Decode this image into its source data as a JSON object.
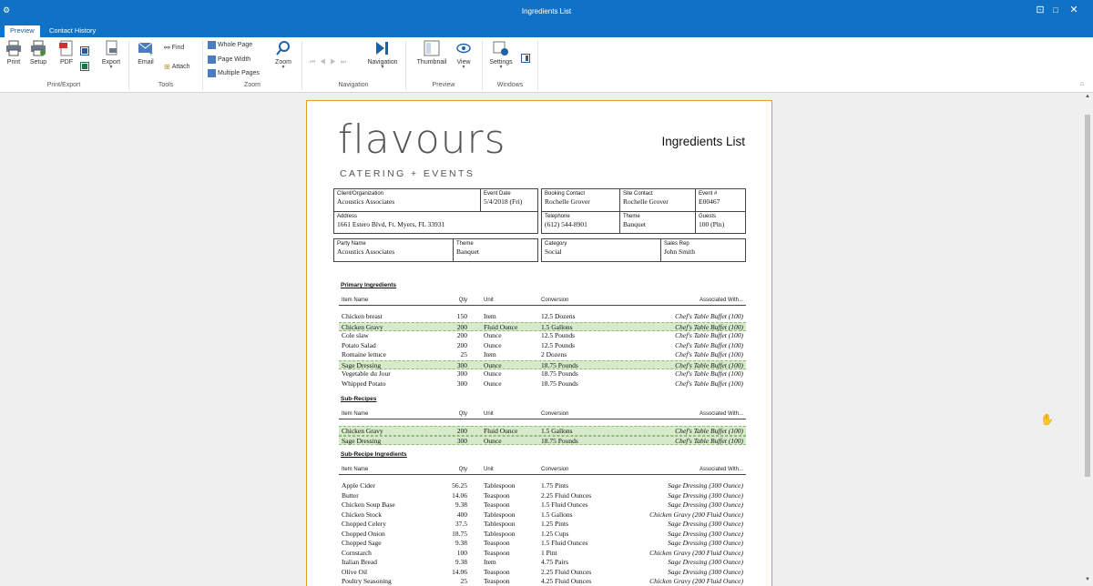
{
  "window": {
    "title": "Ingredients List",
    "app_icon": "app-icon"
  },
  "ribbon_tabs": [
    "Preview",
    "Contact History"
  ],
  "ribbon": {
    "print_export": {
      "print": "Print",
      "setup": "Setup",
      "pdf": "PDF",
      "export": "Export",
      "group": "Print/Export"
    },
    "tools": {
      "email": "Email",
      "find": "Find",
      "attach": "Attach",
      "group": "Tools"
    },
    "zoom": {
      "whole_page": "Whole Page",
      "page_width": "Page Width",
      "multiple_pages": "Multiple Pages",
      "zoom": "Zoom",
      "group": "Zoom"
    },
    "navigation": {
      "navigation": "Navigation",
      "group": "Navigation"
    },
    "preview": {
      "thumbnail": "Thumbnail",
      "view": "View",
      "group": "Preview"
    },
    "windows": {
      "settings": "Settings",
      "group": "Windows"
    }
  },
  "report": {
    "logo_word": "flavours",
    "logo_sub": "CATERING + EVENTS",
    "title": "Ingredients List",
    "box1": {
      "client_label": "Client/Organization",
      "client": "Acoustics Associates",
      "date_label": "Event Date",
      "date": "5/4/2018 (Fri)",
      "address_label": "Address",
      "address": "1661 Estero Blvd, Ft. Myers, FL 33931"
    },
    "box2": {
      "booking_label": "Booking Contact",
      "booking": "Rochelle Grover",
      "site_label": "Site Contact",
      "site": "Rochelle Grover",
      "event_label": "Event #",
      "event": "E00467",
      "phone_label": "Telephone",
      "phone": "(612) 544-8901",
      "theme_label": "Theme",
      "theme": "Banquet",
      "guests_label": "Guests",
      "guests": "100 (Pln)"
    },
    "box3": {
      "party_label": "Party Name",
      "party": "Acoustics Associates",
      "theme_label": "Theme",
      "theme": "Banquet"
    },
    "box4": {
      "category_label": "Category",
      "category": "Social",
      "rep_label": "Sales Rep",
      "rep": "John Smith"
    },
    "columns": {
      "name": "Item Name",
      "qty": "Qty",
      "unit": "Unit",
      "conv": "Conversion",
      "assoc": "Associated With..."
    },
    "sections": [
      {
        "title": "Primary Ingredients",
        "rows": [
          {
            "name": "Chicken breast",
            "qty": "150",
            "unit": "Item",
            "conv": "12.5 Dozens",
            "assoc": "Chef's Table Buffet (100)",
            "hl": false
          },
          {
            "name": "Chicken Gravy",
            "qty": "200",
            "unit": "Fluid Ounce",
            "conv": "1.5 Gallons",
            "assoc": "Chef's Table Buffet (100)",
            "hl": true
          },
          {
            "name": "Cole slaw",
            "qty": "200",
            "unit": "Ounce",
            "conv": "12.5 Pounds",
            "assoc": "Chef's Table Buffet (100)",
            "hl": false
          },
          {
            "name": "Potato Salad",
            "qty": "200",
            "unit": "Ounce",
            "conv": "12.5 Pounds",
            "assoc": "Chef's Table Buffet (100)",
            "hl": false
          },
          {
            "name": "Romaine lettuce",
            "qty": "25",
            "unit": "Item",
            "conv": "2 Dozens",
            "assoc": "Chef's Table Buffet (100)",
            "hl": false
          },
          {
            "name": "Sage Dressing",
            "qty": "300",
            "unit": "Ounce",
            "conv": "18.75 Pounds",
            "assoc": "Chef's Table Buffet (100)",
            "hl": true
          },
          {
            "name": "Vegetable du Jour",
            "qty": "300",
            "unit": "Ounce",
            "conv": "18.75 Pounds",
            "assoc": "Chef's Table Buffet (100)",
            "hl": false
          },
          {
            "name": "Whipped Potato",
            "qty": "300",
            "unit": "Ounce",
            "conv": "18.75 Pounds",
            "assoc": "Chef's Table Buffet (100)",
            "hl": false
          }
        ]
      },
      {
        "title": "Sub-Recipes",
        "rows": [
          {
            "name": "Chicken Gravy",
            "qty": "200",
            "unit": "Fluid Ounce",
            "conv": "1.5 Gallons",
            "assoc": "Chef's Table Buffet (100)",
            "hl": true
          },
          {
            "name": "Sage Dressing",
            "qty": "300",
            "unit": "Ounce",
            "conv": "18.75 Pounds",
            "assoc": "Chef's Table Buffet (100)",
            "hl": true
          }
        ]
      },
      {
        "title": "Sub-Recipe Ingredients",
        "rows": [
          {
            "name": "Apple Cider",
            "qty": "56.25",
            "unit": "Tablespoon",
            "conv": "1.75 Pints",
            "assoc": "Sage Dressing (300 Ounce)",
            "hl": false
          },
          {
            "name": "Butter",
            "qty": "14.06",
            "unit": "Teaspoon",
            "conv": "2.25 Fluid Ounces",
            "assoc": "Sage Dressing (300 Ounce)",
            "hl": false
          },
          {
            "name": "Chicken Soup Base",
            "qty": "9.38",
            "unit": "Teaspoon",
            "conv": "1.5 Fluid Ounces",
            "assoc": "Sage Dressing (300 Ounce)",
            "hl": false
          },
          {
            "name": "Chicken Stock",
            "qty": "400",
            "unit": "Tablespoon",
            "conv": "1.5 Gallons",
            "assoc": "Chicken Gravy (200 Fluid Ounce)",
            "hl": false
          },
          {
            "name": "Chopped Celery",
            "qty": "37.5",
            "unit": "Tablespoon",
            "conv": "1.25 Pints",
            "assoc": "Sage Dressing (300 Ounce)",
            "hl": false
          },
          {
            "name": "Chopped Onion",
            "qty": "18.75",
            "unit": "Tablespoon",
            "conv": "1.25 Cups",
            "assoc": "Sage Dressing (300 Ounce)",
            "hl": false
          },
          {
            "name": "Chopped Sage",
            "qty": "9.38",
            "unit": "Teaspoon",
            "conv": "1.5 Fluid Ounces",
            "assoc": "Sage Dressing (300 Ounce)",
            "hl": false
          },
          {
            "name": "Cornstarch",
            "qty": "100",
            "unit": "Teaspoon",
            "conv": "1 Pint",
            "assoc": "Chicken Gravy (200 Fluid Ounce)",
            "hl": false
          },
          {
            "name": "Italian Bread",
            "qty": "9.38",
            "unit": "Item",
            "conv": "4.75 Pairs",
            "assoc": "Sage Dressing (300 Ounce)",
            "hl": false
          },
          {
            "name": "Olive Oil",
            "qty": "14.06",
            "unit": "Teaspoon",
            "conv": "2.25 Fluid Ounces",
            "assoc": "Sage Dressing (300 Ounce)",
            "hl": false
          },
          {
            "name": "Poultry Seasoning",
            "qty": "25",
            "unit": "Teaspoon",
            "conv": "4.25 Fluid Ounces",
            "assoc": "Chicken Gravy (200 Fluid Ounce)",
            "hl": false
          }
        ]
      }
    ]
  },
  "colors": {
    "titlebar": "#0f72c7",
    "page_border": "#e0a020",
    "highlight_row": "#d7ebcc"
  }
}
